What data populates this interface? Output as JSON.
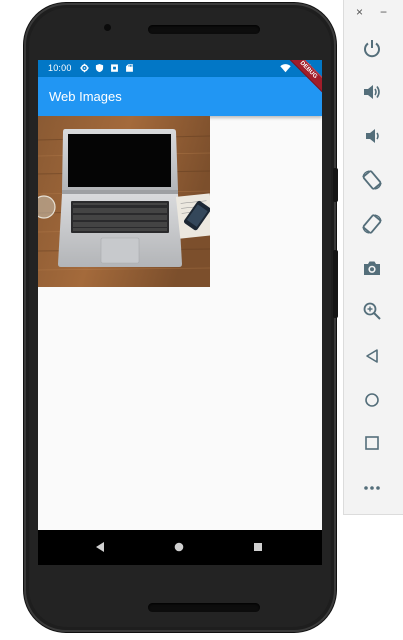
{
  "status_bar": {
    "time": "10:00",
    "icons": [
      "gear-icon",
      "shield-icon",
      "sim-icon",
      "sd-card-icon",
      "wifi-icon",
      "battery-icon"
    ]
  },
  "app_bar": {
    "title": "Web Images",
    "debug_banner": "DEBUG"
  },
  "content": {
    "image": "laptop-on-wooden-desk-photo"
  },
  "nav_bar": {
    "buttons": [
      "back-icon",
      "home-icon",
      "recents-icon"
    ]
  },
  "emulator_controls": {
    "window_buttons": {
      "close": "×",
      "minimize": "−"
    },
    "tools": [
      "power-icon",
      "volume-up-icon",
      "volume-down-icon",
      "rotate-left-icon",
      "rotate-right-icon",
      "camera-icon",
      "zoom-icon",
      "back-icon",
      "home-icon",
      "overview-icon",
      "more-icon"
    ]
  },
  "colors": {
    "status_bar": "#0277c6",
    "app_bar": "#2196f3",
    "screen_background": "#fafafa",
    "debug_ribbon": "#a11d2a",
    "emulator_icon": "#546e7a"
  }
}
